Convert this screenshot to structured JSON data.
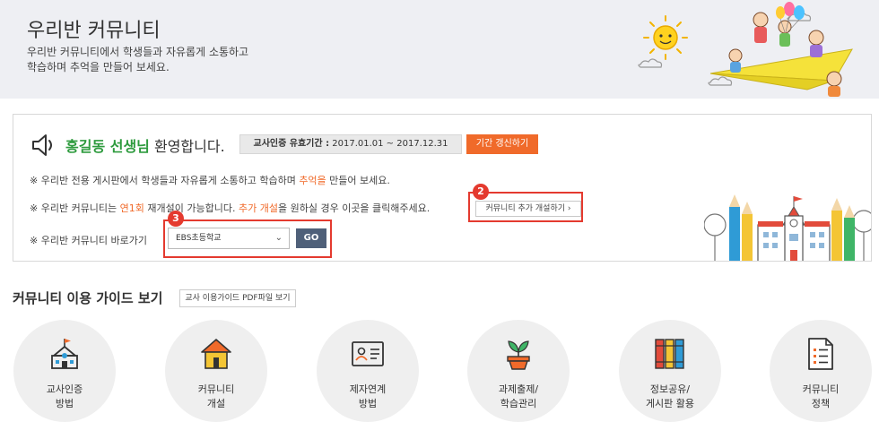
{
  "header": {
    "title": "우리반 커뮤니티",
    "description": "우리반 커뮤니티에서 학생들과 자유롭게 소통하고\n학습하며 추억을 만들어 보세요."
  },
  "welcome": {
    "speaker_icon": "speaker-icon",
    "teacher_name": "홍길동 선생님",
    "greeting_suffix": " 환영합니다.",
    "period_label": "교사인증 유효기간 :",
    "period_value": " 2017.01.01 ~ 2017.12.31",
    "renew_button": "기간 갱신하기"
  },
  "notes": {
    "line1_prefix": "※ 우리반 전용 게시판에서 학생들과 자유롭게 소통하고 학습하며 ",
    "line1_highlight": "추억을",
    "line1_suffix": " 만들어 보세요.",
    "line2_prefix": "※ 우리반 커뮤니티는 ",
    "line2_highlight1": "연1회",
    "line2_mid": " 재개설이 가능합니다. ",
    "line2_highlight2": "추가 개설",
    "line2_suffix": "을 원하실 경우 이곳을 클릭해주세요.",
    "add_button": "커뮤니티 추가 개설하기 ›",
    "line3": "※ 우리반 커뮤니티 바로가기"
  },
  "shortcut": {
    "selected_school": "EBS초등학교",
    "go_button": "GO"
  },
  "annotations": {
    "badge2": "2",
    "badge3": "3",
    "highlight_color": "#e43a2f"
  },
  "guide": {
    "title": "커뮤니티 이용 가이드 보기",
    "pdf_button": "교사 이용가이드 PDF파일 보기",
    "items": [
      {
        "label": "교사인증\n방법",
        "icon": "school-icon"
      },
      {
        "label": "커뮤니티\n개설",
        "icon": "house-icon"
      },
      {
        "label": "제자연계\n방법",
        "icon": "id-card-icon"
      },
      {
        "label": "과제출제/\n학습관리",
        "icon": "plant-icon"
      },
      {
        "label": "정보공유/\n게시판 활용",
        "icon": "books-icon"
      },
      {
        "label": "커뮤니티\n정책",
        "icon": "document-icon"
      }
    ]
  },
  "colors": {
    "accent": "#f06a2a",
    "teacher_name": "#2e9b3e",
    "go_button": "#4f6079",
    "hero_background": "#eeeff3"
  }
}
